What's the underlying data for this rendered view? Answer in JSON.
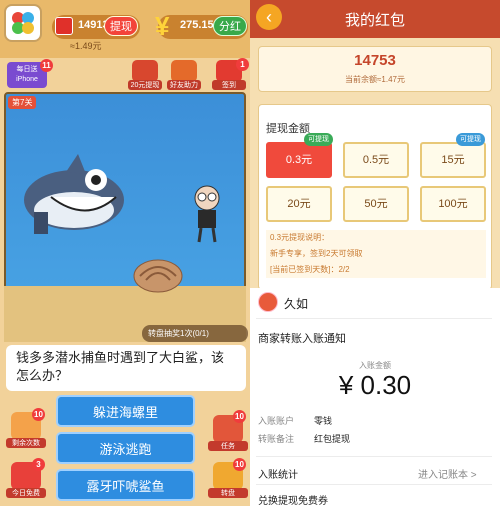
{
  "game": {
    "coins": "14913",
    "withdraw_label": "提现",
    "coins_value": "≈1.49元",
    "cash": "275.15",
    "bonus_label": "分红",
    "iphone_label": "每日送iPhone",
    "iphone_badge": "11",
    "tools": [
      {
        "label": "20元提现",
        "icon": "money-bag-icon"
      },
      {
        "label": "好友助力",
        "icon": "gift-box-icon"
      },
      {
        "label": "签到",
        "icon": "calendar-icon",
        "badge": "1"
      }
    ],
    "level": "第7关",
    "lottery_text": "转盘抽奖1次(0/1)",
    "question": "钱多多潜水捕鱼时遇到了大白鲨，该怎么办？",
    "options": [
      "躲进海螺里",
      "游泳逃跑",
      "露牙吓唬鲨鱼"
    ],
    "left_buttons": [
      {
        "label": "剩余次数",
        "badge": "10",
        "icon": "tap-icon"
      },
      {
        "label": "今日免费",
        "badge": "3",
        "icon": "red-packet-icon"
      }
    ],
    "right_buttons": [
      {
        "label": "任务",
        "badge": "10",
        "icon": "task-icon"
      },
      {
        "label": "转盘",
        "badge": "10",
        "icon": "wheel-icon"
      }
    ]
  },
  "wallet": {
    "title": "我的红包",
    "balance": "14753",
    "balance_sub": "当前余额≈1.47元",
    "withdraw_title": "提现金额",
    "amounts": [
      "0.3元",
      "0.5元",
      "15元",
      "20元",
      "50元",
      "100元"
    ],
    "tag_withdrawable": "可提现",
    "tag_right": "可提现",
    "notes": [
      "0.3元提现说明：",
      "新手专享，签到2天可领取",
      "[当前已签到天数]：2/2"
    ]
  },
  "notice": {
    "sender": "久如",
    "title": "商家转账入账通知",
    "amount_label": "入账金额",
    "amount": "¥ 0.30",
    "rows": [
      {
        "key": "入账账户",
        "value": "零钱"
      },
      {
        "key": "转账备注",
        "value": "红包提现"
      }
    ],
    "stat_label": "入账统计",
    "stat_link": "进入记账本 >",
    "redeem_label": "兑换提现免费券"
  },
  "colors": {
    "wallet_header": "#c64a2d",
    "option_blue": "#2e8de0",
    "selected_red": "#f04a3c"
  }
}
